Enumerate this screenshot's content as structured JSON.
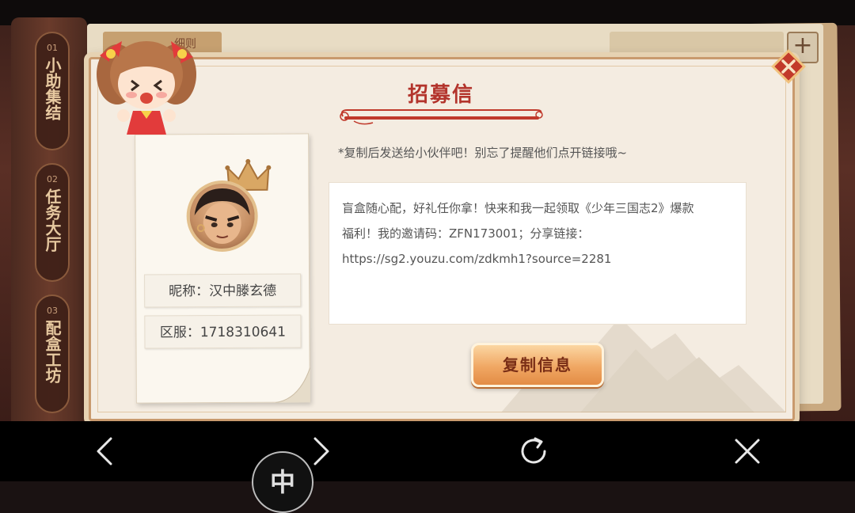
{
  "background": {
    "rail_items": [
      {
        "num": "01",
        "label": "小助集结"
      },
      {
        "num": "02",
        "label": "任务大厅"
      },
      {
        "num": "03",
        "label": "配盒工坊"
      }
    ],
    "tab_left_label": "细则"
  },
  "dialog": {
    "title": "招募信",
    "hint": "*复制后发送给小伙伴吧！别忘了提醒他们点开链接哦~",
    "message_lines": [
      "盲盒随心配，好礼任你拿！快来和我一起领取《少年三国志2》爆款",
      "福利！我的邀请码：ZFN173001；分享链接：",
      "https://sg2.youzu.com/zdkmh1?source=2281"
    ],
    "copy_button_label": "复制信息",
    "profile": {
      "nickname": "昵称：汉中滕玄德",
      "server": "区服：1718310641"
    }
  },
  "browser_bar": {
    "floating_badge_label": "中",
    "icons": [
      "back-icon",
      "forward-icon",
      "refresh-icon",
      "close-icon"
    ]
  },
  "colors": {
    "title_red": "#b3342c",
    "button_orange": "#f0a763",
    "close_red": "#c23a2a"
  }
}
